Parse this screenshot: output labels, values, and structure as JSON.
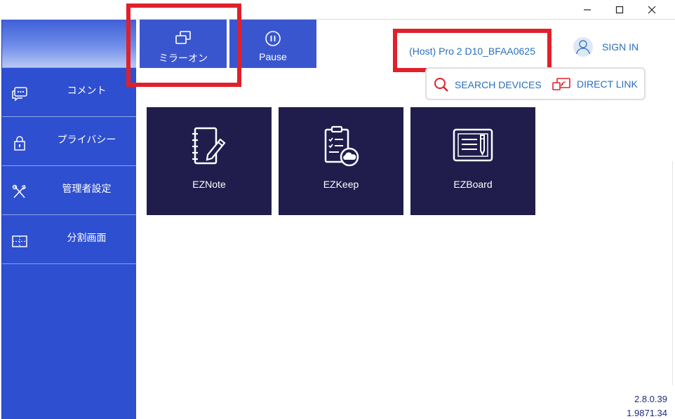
{
  "window": {
    "controls": [
      {
        "name": "minimize-icon"
      },
      {
        "name": "maximize-icon"
      },
      {
        "name": "close-icon"
      }
    ]
  },
  "sidebar": {
    "items": [
      {
        "label": "コメント",
        "icon": "comment-icon"
      },
      {
        "label": "プライバシー",
        "icon": "lock-icon"
      },
      {
        "label": "管理者設定",
        "icon": "tools-icon"
      },
      {
        "label": "分割画面",
        "icon": "split-screen-icon"
      }
    ]
  },
  "toolbar": {
    "mirror_label": "ミラーオン",
    "mirror_icon": "mirror-icon",
    "pause_label": "Pause",
    "pause_icon": "pause-icon"
  },
  "device": {
    "name": "(Host) Pro 2 D10_BFAA0625"
  },
  "account": {
    "signin_label": "SIGN IN",
    "avatar_icon": "user-avatar-icon"
  },
  "connect": {
    "search_label": "SEARCH DEVICES",
    "search_icon": "search-icon",
    "direct_label": "DIRECT LINK",
    "direct_icon": "direct-link-icon"
  },
  "apps": [
    {
      "label": "EZNote",
      "icon": "notebook-pen-icon"
    },
    {
      "label": "EZKeep",
      "icon": "clipboard-cloud-icon"
    },
    {
      "label": "EZBoard",
      "icon": "whiteboard-pen-icon"
    }
  ],
  "version": {
    "line1": "2.8.0.39",
    "line2": "1.9871.34"
  },
  "colors": {
    "sidebar": "#2e4fd0",
    "button": "#3a56cf",
    "tile": "#201d4c",
    "link_text": "#2a6fbf",
    "highlight": "#e0202a"
  }
}
